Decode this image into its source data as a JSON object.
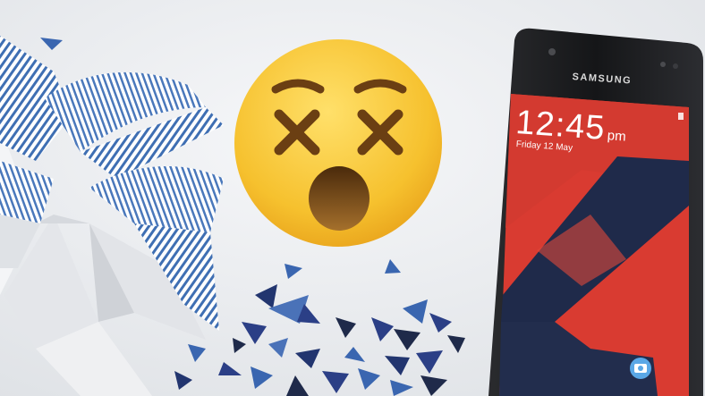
{
  "phone": {
    "brand": "SAMSUNG",
    "lockscreen": {
      "time": "12:45",
      "ampm": "pm",
      "date": "Friday 12 May"
    }
  },
  "emoji": {
    "icon": "dizzy-face-emoji-icon",
    "face_color": "#f6c12e",
    "feature_color": "#6b3f13"
  },
  "colors": {
    "background": "#e9ebee",
    "pinwheel_stripe": "#3f6fb3",
    "screen_red": "#d93b31",
    "screen_navy": "#1f2a4a",
    "shard_blue": "#2b3f86"
  },
  "icons": {
    "pinwheel": "pinwheel-icon",
    "camera": "camera-icon",
    "triangle_shards": "triangle-shard-icon"
  }
}
